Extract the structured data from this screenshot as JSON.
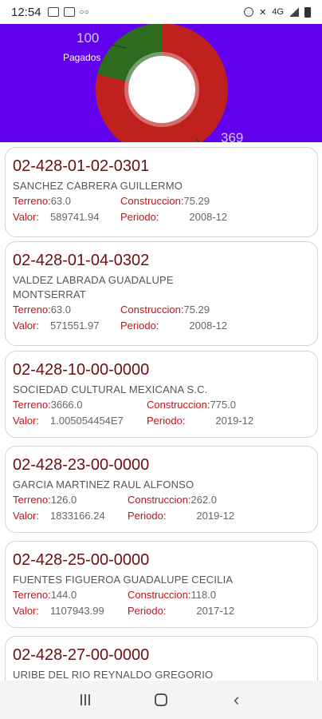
{
  "status_bar": {
    "time": "12:54",
    "left_icons": [
      "message-icon",
      "image-icon",
      "voicemail-icon"
    ],
    "right_icons": [
      "alarm-icon",
      "mute-icon",
      "data-icon",
      "signal-icon",
      "battery-icon"
    ],
    "data_label": "4G"
  },
  "header": {
    "background": "#6200ee",
    "pagados_count": "100",
    "pagados_label": "Pagados",
    "pending_count": "369",
    "chart_colors": {
      "pagados": "#2e6b1e",
      "pendientes": "#c0201e",
      "hole": "#ffffff"
    }
  },
  "chart_data": {
    "type": "pie",
    "categories": [
      "Pagados",
      ""
    ],
    "values": [
      100,
      369
    ],
    "colors": [
      "#2e6b1e",
      "#c0201e"
    ],
    "donut": true
  },
  "labels": {
    "terreno": "Terreno:",
    "construccion": "Construccion:",
    "valor": "Valor:",
    "periodo": "Periodo:"
  },
  "records": [
    {
      "clave": "02-428-01-02-0301",
      "owner": "SANCHEZ CABRERA GUILLERMO",
      "terreno": "63.0",
      "construccion": "75.29",
      "valor": "589741.94",
      "periodo": "2008-12"
    },
    {
      "clave": "02-428-01-04-0302",
      "owner": "VALDEZ LABRADA GUADALUPE MONTSERRAT",
      "terreno": "63.0",
      "construccion": "75.29",
      "valor": "571551.97",
      "periodo": "2008-12"
    },
    {
      "clave": "02-428-10-00-0000",
      "owner": "SOCIEDAD CULTURAL MEXICANA S.C.",
      "terreno": "3666.0",
      "construccion": "775.0",
      "valor": "1.005054454E7",
      "periodo": "2019-12"
    },
    {
      "clave": "02-428-23-00-0000",
      "owner": "GARCIA MARTINEZ RAUL ALFONSO",
      "terreno": "126.0",
      "construccion": "262.0",
      "valor": "1833166.24",
      "periodo": "2019-12"
    },
    {
      "clave": "02-428-25-00-0000",
      "owner": "FUENTES FIGUEROA GUADALUPE CECILIA",
      "terreno": "144.0",
      "construccion": "118.0",
      "valor": "1107943.99",
      "periodo": "2017-12"
    },
    {
      "clave": "02-428-27-00-0000",
      "owner": "URIBE DEL RIO REYNALDO GREGORIO"
    }
  ],
  "nav_bar": {
    "icons": [
      "recents-icon",
      "home-icon",
      "back-icon"
    ]
  }
}
